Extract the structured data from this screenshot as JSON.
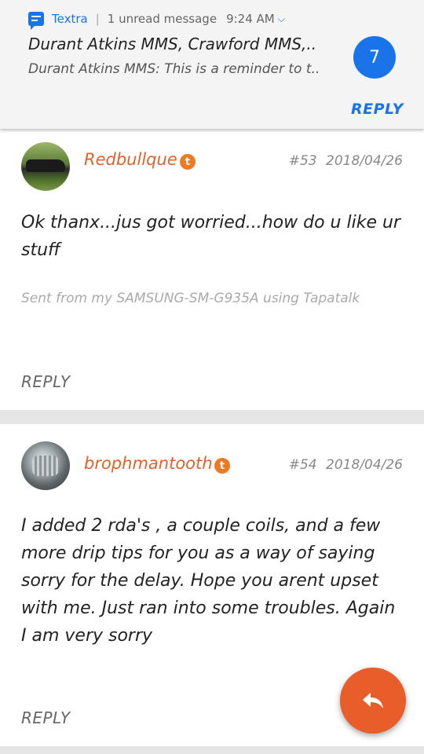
{
  "notification": {
    "app_name": "Textra",
    "status": "1 unread message",
    "time": "9:24 AM",
    "title": "Durant Atkins MMS, Crawford MMS,..",
    "preview": "Durant Atkins MMS: This is a reminder to t..",
    "count": "7",
    "reply_label": "REPLY",
    "icons": [
      "message-icon",
      "chevron-down-icon"
    ]
  },
  "posts": [
    {
      "username": "Redbullque",
      "badge": "t",
      "number": "#53",
      "date": "2018/04/26",
      "text": "Ok thanx...jus got worried...how do u like ur stuff",
      "signature": "Sent from my SAMSUNG-SM-G935A using Tapatalk",
      "reply_label": "REPLY"
    },
    {
      "username": "brophmantooth",
      "badge": "t",
      "number": "#54",
      "date": "2018/04/26",
      "text": "I added 2 rda's , a couple coils, and a few more drip tips for you as a way of saying sorry for the delay. Hope you arent upset with me. Just ran into some troubles. Again I am very sorry",
      "reply_label": "REPLY"
    }
  ],
  "fab": {
    "icon": "reply-icon"
  },
  "colors": {
    "accent_blue": "#1a73e8",
    "username_orange": "#e2622b",
    "fab_orange": "#e85d2a"
  }
}
